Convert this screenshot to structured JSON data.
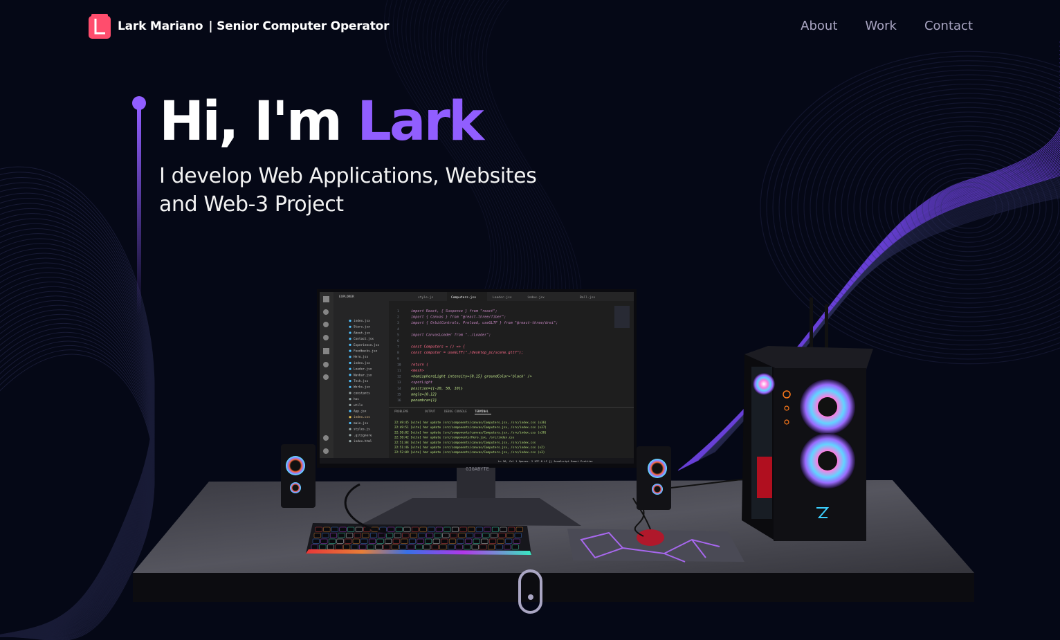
{
  "nav": {
    "brand_name": "Lark Mariano",
    "brand_role": "| Senior Computer Operator",
    "links": [
      {
        "label": "About"
      },
      {
        "label": "Work"
      },
      {
        "label": "Contact"
      }
    ]
  },
  "hero": {
    "greeting": "Hi, I'm ",
    "name": "Lark",
    "subtitle_line1": "I develop Web Applications, Websites",
    "subtitle_line2": "and Web-3 Project"
  },
  "scene": {
    "monitor_brand": "GIGABYTE",
    "editor": {
      "tabs": [
        "style.js",
        "Computers.jsx",
        "Loader.jsx",
        "index.jsx",
        "Ball.jsx"
      ],
      "explorer_title": "EXPLORER",
      "files": [
        "index.jsx",
        "Stars.jsx",
        "About.jsx",
        "Contact.jsx",
        "Experience.jsx",
        "Feedbacks.jsx",
        "Hero.jsx",
        "index.jsx",
        "Loader.jsx",
        "Navbar.jsx",
        "Tech.jsx",
        "Works.jsx",
        "constants",
        "hoc",
        "utils",
        "App.jsx",
        "index.css",
        "main.jsx",
        "styles.js",
        ".gitignore",
        "index.html"
      ],
      "code_lines": [
        "import React, { Suspense } from \"react\";",
        "import { Canvas } from \"@react-three/fiber\";",
        "import { OrbitControls, Preload, useGLTF } from \"@react-three/drei\";",
        "",
        "import CanvasLoader from \"../Loader\";",
        "",
        "const Computers = () => {",
        "  const computer = useGLTF(\"./desktop_pc/scene.gltf\");",
        "",
        "  return (",
        "    <mesh>",
        "      <hemisphereLight intensity={0.15} groundColor='black' />",
        "      <spotLight",
        "        position={[-20, 50, 10]}",
        "        angle={0.12}",
        "        penumbra={1}"
      ],
      "panel_tabs": [
        "PROBLEMS",
        "OUTPUT",
        "DEBUG CONSOLE",
        "TERMINAL"
      ],
      "terminal_lines": [
        "22:49:45 [vite] hmr update /src/components/canvas/Computers.jsx, /src/index.css (x36)",
        "22:49:51 [vite] hmr update /src/components/canvas/Computers.jsx, /src/index.css (x37)",
        "22:50:02 [vite] hmr update /src/components/canvas/Computers.jsx, /src/index.css (x38)",
        "22:50:42 [vite] hmr update /src/components/Hero.jsx, /src/index.css",
        "22:51:04 [vite] hmr update /src/components/canvas/Computers.jsx, /src/index.css",
        "22:51:46 [vite] hmr update /src/components/canvas/Computers.jsx, /src/index.css (x2)",
        "22:52:09 [vite] hmr update /src/components/canvas/Computers.jsx, /src/index.css (x3)"
      ],
      "status_right": "Ln 56, Col 1   Spaces: 2   UTF-8   LF   {} JavaScript React   Prettier"
    }
  },
  "colors": {
    "background": "#050816",
    "accent": "#915eff",
    "nav_link": "#aaa6c3",
    "logo": "#ff4d6d"
  }
}
